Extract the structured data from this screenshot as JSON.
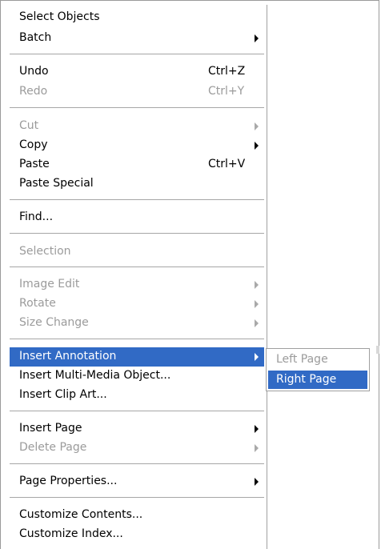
{
  "menu": {
    "select_objects": "Select Objects",
    "batch": "Batch",
    "undo": "Undo",
    "undo_shortcut": "Ctrl+Z",
    "redo": "Redo",
    "redo_shortcut": "Ctrl+Y",
    "cut": "Cut",
    "copy": "Copy",
    "paste": "Paste",
    "paste_shortcut": "Ctrl+V",
    "paste_special": "Paste Special",
    "find": "Find...",
    "selection": "Selection",
    "image_edit": "Image Edit",
    "rotate": "Rotate",
    "size_change": "Size Change",
    "insert_annotation": "Insert Annotation",
    "insert_multimedia": "Insert Multi-Media Object...",
    "insert_clip_art": "Insert Clip Art...",
    "insert_page": "Insert Page",
    "delete_page": "Delete Page",
    "page_properties": "Page Properties...",
    "customize_contents": "Customize Contents...",
    "customize_index": "Customize Index..."
  },
  "submenu": {
    "left_page": "Left Page",
    "right_page": "Right Page"
  },
  "colors": {
    "highlight": "#316ac5",
    "disabled_text": "#9b9b9b"
  }
}
